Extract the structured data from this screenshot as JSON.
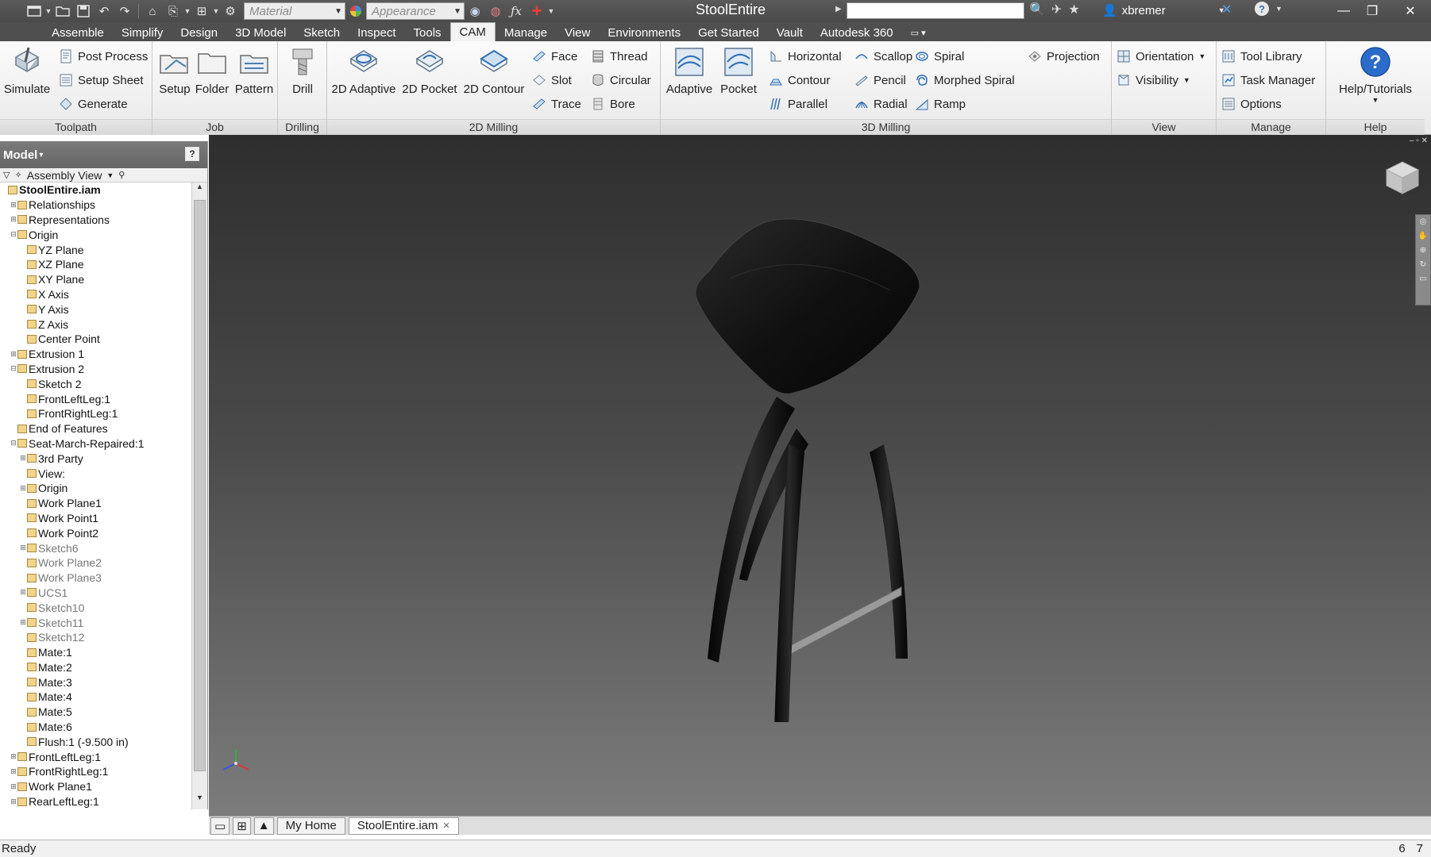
{
  "titlebar": {
    "material_placeholder": "Material",
    "appearance_placeholder": "Appearance",
    "title": "StoolEntire",
    "username": "xbremer"
  },
  "tabs": [
    "Assemble",
    "Simplify",
    "Design",
    "3D Model",
    "Sketch",
    "Inspect",
    "Tools",
    "CAM",
    "Manage",
    "View",
    "Environments",
    "Get Started",
    "Vault",
    "Autodesk 360"
  ],
  "active_tab": "CAM",
  "ribbon": {
    "toolpath": {
      "title": "Toolpath",
      "simulate": "Simulate",
      "post_process": "Post Process",
      "setup_sheet": "Setup Sheet",
      "generate": "Generate"
    },
    "job": {
      "title": "Job",
      "setup": "Setup",
      "folder": "Folder",
      "pattern": "Pattern"
    },
    "drilling": {
      "title": "Drilling",
      "drill": "Drill"
    },
    "milling2d": {
      "title": "2D Milling",
      "adaptive": "2D Adaptive",
      "pocket": "2D Pocket",
      "contour": "2D Contour",
      "face": "Face",
      "slot": "Slot",
      "trace": "Trace",
      "thread": "Thread",
      "circular": "Circular",
      "bore": "Bore"
    },
    "milling3d": {
      "title": "3D Milling",
      "adaptive": "Adaptive",
      "pocket": "Pocket",
      "horizontal": "Horizontal",
      "contour": "Contour",
      "parallel": "Parallel",
      "scallop": "Scallop",
      "pencil": "Pencil",
      "radial": "Radial",
      "spiral": "Spiral",
      "morphed_spiral": "Morphed Spiral",
      "ramp": "Ramp",
      "projection": "Projection"
    },
    "view": {
      "title": "View",
      "orientation": "Orientation",
      "visibility": "Visibility"
    },
    "manage": {
      "title": "Manage",
      "tool_library": "Tool Library",
      "task_manager": "Task Manager",
      "options": "Options"
    },
    "help": {
      "title": "Help",
      "tutorials": "Help/Tutorials"
    }
  },
  "browser": {
    "title": "Model",
    "view_mode": "Assembly View",
    "tree": [
      {
        "label": "StoolEntire.iam",
        "level": 0,
        "bold": true
      },
      {
        "label": "Relationships",
        "level": 1,
        "exp": "+"
      },
      {
        "label": "Representations",
        "level": 1,
        "exp": "+"
      },
      {
        "label": "Origin",
        "level": 1,
        "exp": "-"
      },
      {
        "label": "YZ Plane",
        "level": 2
      },
      {
        "label": "XZ Plane",
        "level": 2
      },
      {
        "label": "XY Plane",
        "level": 2
      },
      {
        "label": "X Axis",
        "level": 2
      },
      {
        "label": "Y Axis",
        "level": 2
      },
      {
        "label": "Z Axis",
        "level": 2
      },
      {
        "label": "Center Point",
        "level": 2
      },
      {
        "label": "Extrusion 1",
        "level": 1,
        "exp": "+"
      },
      {
        "label": "Extrusion 2",
        "level": 1,
        "exp": "-"
      },
      {
        "label": "Sketch 2",
        "level": 2
      },
      {
        "label": "FrontLeftLeg:1",
        "level": 2
      },
      {
        "label": "FrontRightLeg:1",
        "level": 2
      },
      {
        "label": "End of Features",
        "level": 1
      },
      {
        "label": "Seat-March-Repaired:1",
        "level": 1,
        "exp": "-"
      },
      {
        "label": "3rd Party",
        "level": 2,
        "exp": "+"
      },
      {
        "label": "View:",
        "level": 2
      },
      {
        "label": "Origin",
        "level": 2,
        "exp": "+"
      },
      {
        "label": "Work Plane1",
        "level": 2
      },
      {
        "label": "Work Point1",
        "level": 2
      },
      {
        "label": "Work Point2",
        "level": 2
      },
      {
        "label": "Sketch6",
        "level": 2,
        "exp": "+",
        "dim": true
      },
      {
        "label": "Work Plane2",
        "level": 2,
        "dim": true
      },
      {
        "label": "Work Plane3",
        "level": 2,
        "dim": true
      },
      {
        "label": "UCS1",
        "level": 2,
        "exp": "+",
        "dim": true
      },
      {
        "label": "Sketch10",
        "level": 2,
        "dim": true
      },
      {
        "label": "Sketch11",
        "level": 2,
        "exp": "+",
        "dim": true
      },
      {
        "label": "Sketch12",
        "level": 2,
        "dim": true
      },
      {
        "label": "Mate:1",
        "level": 2
      },
      {
        "label": "Mate:2",
        "level": 2
      },
      {
        "label": "Mate:3",
        "level": 2
      },
      {
        "label": "Mate:4",
        "level": 2
      },
      {
        "label": "Mate:5",
        "level": 2
      },
      {
        "label": "Mate:6",
        "level": 2
      },
      {
        "label": "Flush:1 (-9.500 in)",
        "level": 2
      },
      {
        "label": "FrontLeftLeg:1",
        "level": 1,
        "exp": "+"
      },
      {
        "label": "FrontRightLeg:1",
        "level": 1,
        "exp": "+"
      },
      {
        "label": "Work Plane1",
        "level": 1,
        "exp": "+"
      },
      {
        "label": "RearLeftLeg:1",
        "level": 1,
        "exp": "+"
      }
    ]
  },
  "doc_tabs": [
    "My Home",
    "StoolEntire.iam"
  ],
  "status": {
    "text": "Ready",
    "count_a": "6",
    "count_b": "7"
  }
}
